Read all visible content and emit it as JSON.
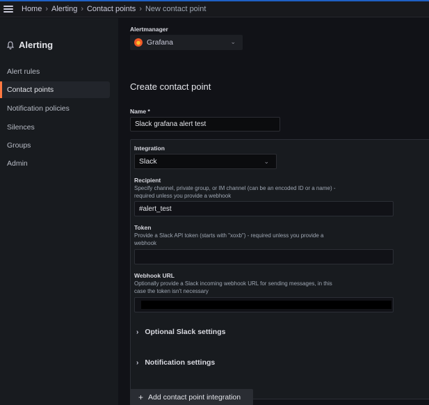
{
  "breadcrumb": [
    "Home",
    "Alerting",
    "Contact points",
    "New contact point"
  ],
  "sidebar": {
    "title": "Alerting",
    "items": [
      {
        "label": "Alert rules"
      },
      {
        "label": "Contact points"
      },
      {
        "label": "Notification policies"
      },
      {
        "label": "Silences"
      },
      {
        "label": "Groups"
      },
      {
        "label": "Admin"
      }
    ]
  },
  "alertmanager": {
    "label": "Alertmanager",
    "value": "Grafana"
  },
  "form": {
    "heading": "Create contact point",
    "name_label": "Name *",
    "name_value": "Slack grafana alert test",
    "integration": {
      "label": "Integration",
      "value": "Slack"
    },
    "recipient": {
      "label": "Recipient",
      "desc1": "Specify channel, private group, or IM channel (can be an encoded ID or a name) -",
      "desc2": "required unless you provide a webhook",
      "value": "#alert_test"
    },
    "token": {
      "label": "Token",
      "desc1": "Provide a Slack API token (starts with \"xoxb\") - required unless you provide a",
      "desc2": "webhook",
      "value": ""
    },
    "webhook": {
      "label": "Webhook URL",
      "desc1": "Optionally provide a Slack incoming webhook URL for sending messages, in this",
      "desc2": "case the token isn't necessary"
    },
    "optional_settings": "Optional Slack settings",
    "notification_settings": "Notification settings",
    "add_button": "Add contact point integration"
  },
  "colors": {
    "active_accent": "#ff7941",
    "top_accent": "#1f60c4"
  }
}
